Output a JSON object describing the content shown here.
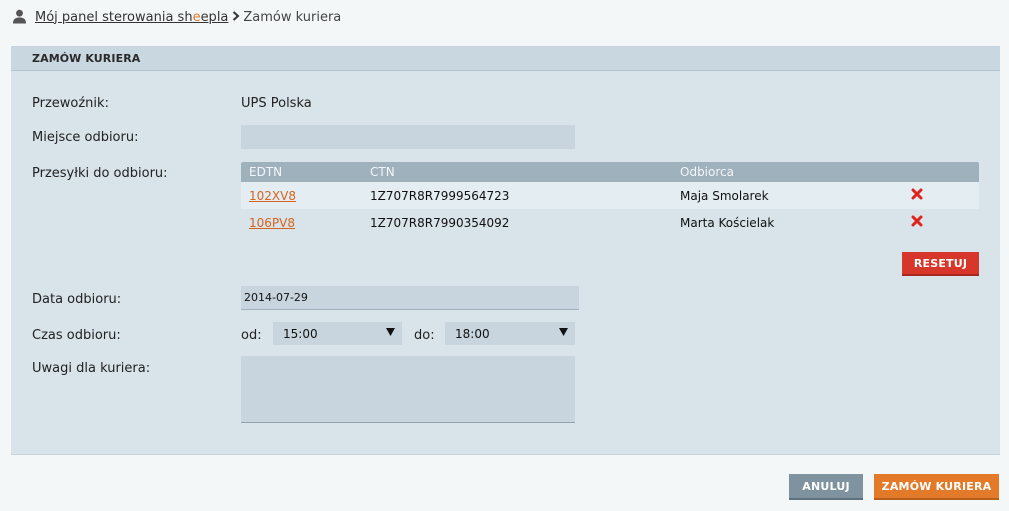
{
  "breadcrumb": {
    "link_prefix": "Mój panel sterowania sh",
    "link_accent": "e",
    "link_suffix": "epla",
    "current": "Zamów kuriera"
  },
  "panel": {
    "title": "ZAMÓW KURIERA"
  },
  "form": {
    "carrier_label": "Przewoźnik:",
    "carrier_value": "UPS Polska",
    "pickup_place_label": "Miejsce odbioru:",
    "pickup_place_value": "",
    "shipments_label": "Przesyłki do odbioru:",
    "date_label": "Data odbioru:",
    "date_value": "2014-07-29",
    "time_label": "Czas odbioru:",
    "from_label": "od:",
    "from_value": "15:00",
    "to_label": "do:",
    "to_value": "18:00",
    "notes_label": "Uwagi dla kuriera:",
    "notes_value": ""
  },
  "shipments": {
    "headers": [
      "EDTN",
      "CTN",
      "Odbiorca"
    ],
    "rows": [
      {
        "edtn": "102XV8",
        "ctn": "1Z707R8R7999564723",
        "recipient": "Maja Smolarek"
      },
      {
        "edtn": "106PV8",
        "ctn": "1Z707R8R7990354092",
        "recipient": "Marta Kościelak"
      }
    ],
    "reset_label": "RESETUJ"
  },
  "actions": {
    "cancel_label": "ANULUJ",
    "submit_label": "ZAMÓW KURIERA"
  },
  "colors": {
    "accent_orange": "#e27a2a",
    "danger_red": "#d7362b",
    "link_orange": "#d5641f",
    "panel_bg": "#d8e3ea",
    "table_head": "#9fb1bd"
  },
  "icons": {
    "user": "user-icon",
    "delete": "delete-x-icon",
    "dropdown": "dropdown-arrow-icon"
  }
}
